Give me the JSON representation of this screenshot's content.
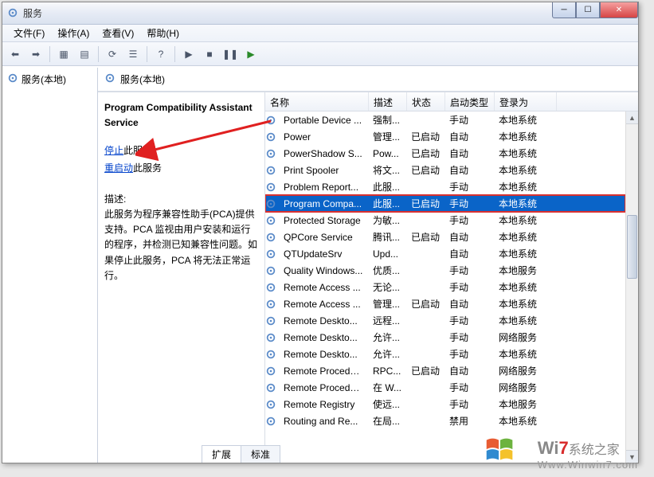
{
  "window": {
    "title": "服务"
  },
  "menu": {
    "file": "文件(F)",
    "action": "操作(A)",
    "view": "查看(V)",
    "help": "帮助(H)"
  },
  "tree": {
    "root": "服务(本地)"
  },
  "panel": {
    "header": "服务(本地)"
  },
  "detail": {
    "service_name": "Program Compatibility Assistant Service",
    "stop_link": "停止",
    "stop_suffix": "此服务",
    "restart_link": "重启动",
    "restart_suffix": "此服务",
    "desc_label": "描述:",
    "desc_text": "此服务为程序兼容性助手(PCA)提供支持。PCA 监视由用户安装和运行的程序，并检测已知兼容性问题。如果停止此服务，PCA 将无法正常运行。"
  },
  "columns": {
    "name": "名称",
    "desc": "描述",
    "status": "状态",
    "startup": "启动类型",
    "logon": "登录为"
  },
  "services": [
    {
      "name": "Portable Device ...",
      "desc": "强制...",
      "status": "",
      "startup": "手动",
      "logon": "本地系统"
    },
    {
      "name": "Power",
      "desc": "管理...",
      "status": "已启动",
      "startup": "自动",
      "logon": "本地系统"
    },
    {
      "name": "PowerShadow S...",
      "desc": "Pow...",
      "status": "已启动",
      "startup": "自动",
      "logon": "本地系统"
    },
    {
      "name": "Print Spooler",
      "desc": "将文...",
      "status": "已启动",
      "startup": "自动",
      "logon": "本地系统"
    },
    {
      "name": "Problem Report...",
      "desc": "此服...",
      "status": "",
      "startup": "手动",
      "logon": "本地系统"
    },
    {
      "name": "Program Compa...",
      "desc": "此服...",
      "status": "已启动",
      "startup": "手动",
      "logon": "本地系统",
      "selected": true
    },
    {
      "name": "Protected Storage",
      "desc": "为敏...",
      "status": "",
      "startup": "手动",
      "logon": "本地系统"
    },
    {
      "name": "QPCore Service",
      "desc": "腾讯...",
      "status": "已启动",
      "startup": "自动",
      "logon": "本地系统"
    },
    {
      "name": "QTUpdateSrv",
      "desc": "Upd...",
      "status": "",
      "startup": "自动",
      "logon": "本地系统"
    },
    {
      "name": "Quality Windows...",
      "desc": "优质...",
      "status": "",
      "startup": "手动",
      "logon": "本地服务"
    },
    {
      "name": "Remote Access ...",
      "desc": "无论...",
      "status": "",
      "startup": "手动",
      "logon": "本地系统"
    },
    {
      "name": "Remote Access ...",
      "desc": "管理...",
      "status": "已启动",
      "startup": "自动",
      "logon": "本地系统"
    },
    {
      "name": "Remote Deskto...",
      "desc": "远程...",
      "status": "",
      "startup": "手动",
      "logon": "本地系统"
    },
    {
      "name": "Remote Deskto...",
      "desc": "允许...",
      "status": "",
      "startup": "手动",
      "logon": "网络服务"
    },
    {
      "name": "Remote Deskto...",
      "desc": "允许...",
      "status": "",
      "startup": "手动",
      "logon": "本地系统"
    },
    {
      "name": "Remote Procedu...",
      "desc": "RPC...",
      "status": "已启动",
      "startup": "自动",
      "logon": "网络服务"
    },
    {
      "name": "Remote Procedu...",
      "desc": "在 W...",
      "status": "",
      "startup": "手动",
      "logon": "网络服务"
    },
    {
      "name": "Remote Registry",
      "desc": "使远...",
      "status": "",
      "startup": "手动",
      "logon": "本地服务"
    },
    {
      "name": "Routing and Re...",
      "desc": "在局...",
      "status": "",
      "startup": "禁用",
      "logon": "本地系统"
    }
  ],
  "tabs": {
    "extended": "扩展",
    "standard": "标准"
  },
  "watermark": {
    "brand_a": "Wi",
    "brand_b": "7",
    "brand_c": "系统之家",
    "url": "Www.Winwin7.com"
  }
}
